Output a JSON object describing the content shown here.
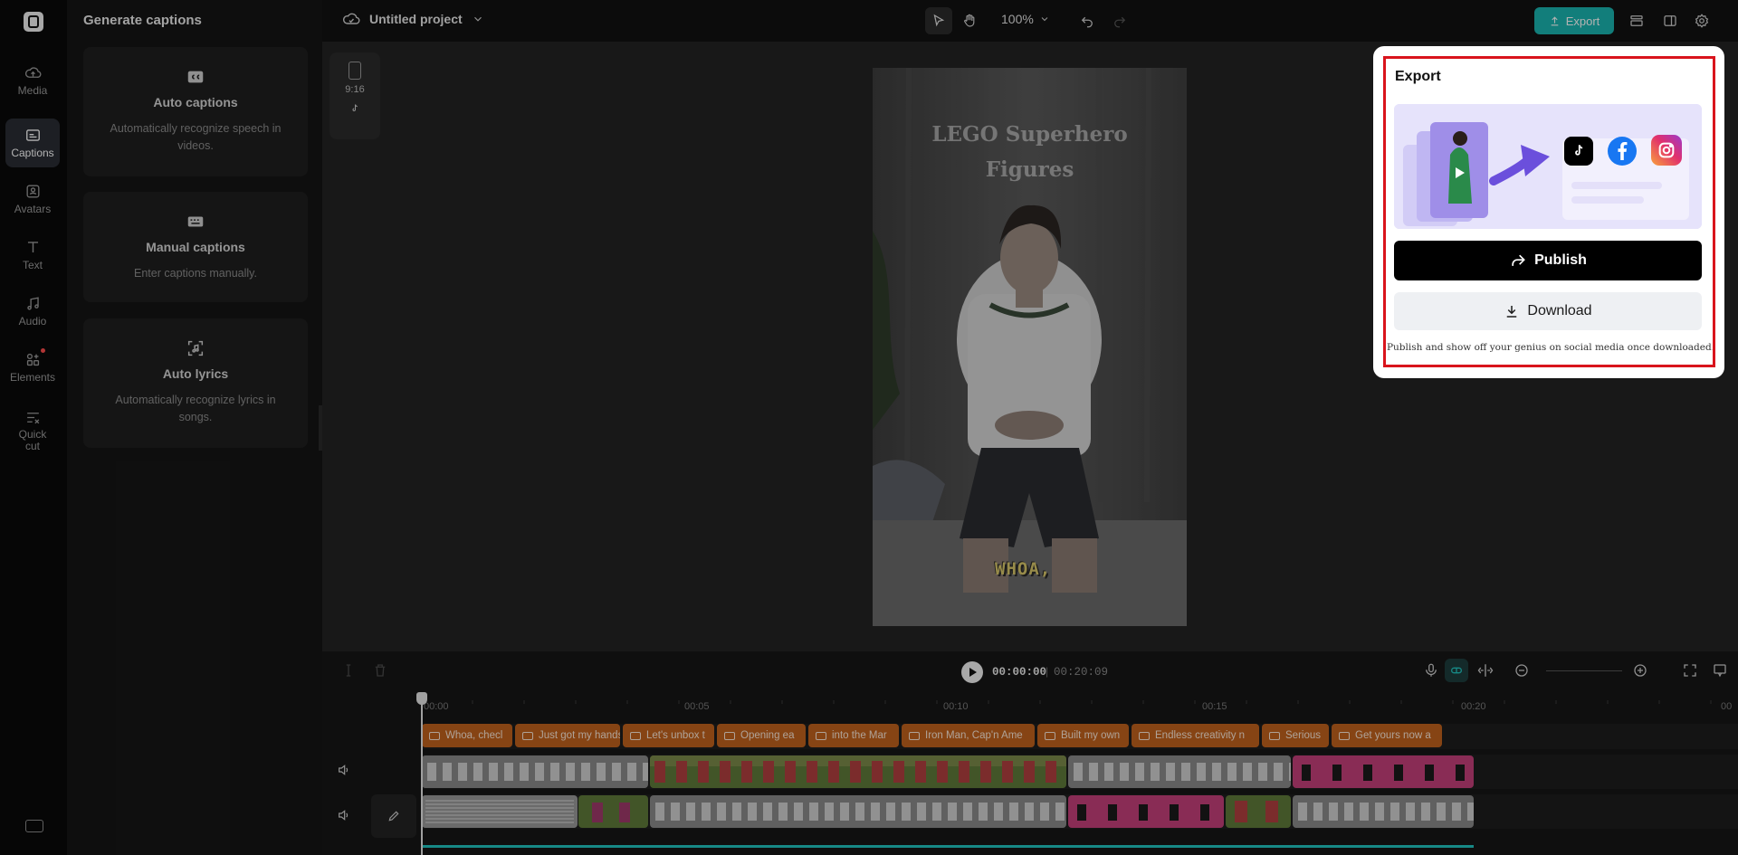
{
  "rail": {
    "items": [
      {
        "label": "Media",
        "icon": "cloud-upload-icon"
      },
      {
        "label": "Captions",
        "icon": "captions-icon"
      },
      {
        "label": "Avatars",
        "icon": "avatar-icon"
      },
      {
        "label": "Text",
        "icon": "text-icon"
      },
      {
        "label": "Audio",
        "icon": "music-note-icon"
      },
      {
        "label": "Elements",
        "icon": "elements-icon"
      },
      {
        "label": "Quick",
        "label2": "cut",
        "icon": "quick-cut-icon"
      }
    ],
    "active": "Captions"
  },
  "panel": {
    "title": "Generate captions",
    "cards": [
      {
        "title": "Auto captions",
        "desc": "Automatically recognize speech in videos.",
        "icon": "auto-captions-icon"
      },
      {
        "title": "Manual captions",
        "desc": "Enter captions manually.",
        "icon": "keyboard-icon"
      },
      {
        "title": "Auto lyrics",
        "desc": "Automatically recognize lyrics in songs.",
        "icon": "lyrics-icon"
      }
    ]
  },
  "topbar": {
    "project_name": "Untitled project",
    "zoom": "100%",
    "export_label": "Export"
  },
  "stage": {
    "ratio": "9:16"
  },
  "video": {
    "title_line1": "LEGO Superhero",
    "title_line2": "Figures",
    "caption": "WHOA,"
  },
  "timeline": {
    "current_time": "00:00:00",
    "separator": "|",
    "total_time": "00:20:09",
    "ticks": [
      "00:00",
      "00:05",
      "00:10",
      "00:15",
      "00:20",
      "00"
    ],
    "captions": [
      "Whoa, checl",
      "Just got my hands o",
      "Let's unbox t",
      "Opening ea",
      "into the Mar",
      "Iron Man, Cap'n Ame",
      "Built my own",
      "Endless creativity n",
      "Serious",
      "Get yours now a"
    ]
  },
  "export_popup": {
    "title": "Export",
    "publish_label": "Publish",
    "download_label": "Download",
    "tip": "Publish and show off your genius on social media once downloaded.",
    "social_icons": [
      "tiktok-icon",
      "facebook-icon",
      "instagram-icon"
    ]
  },
  "colors": {
    "accent": "#1bb5b0",
    "caption_chip": "#c0621e",
    "highlight_frame": "#d9141c",
    "publish_bg": "#000000"
  }
}
